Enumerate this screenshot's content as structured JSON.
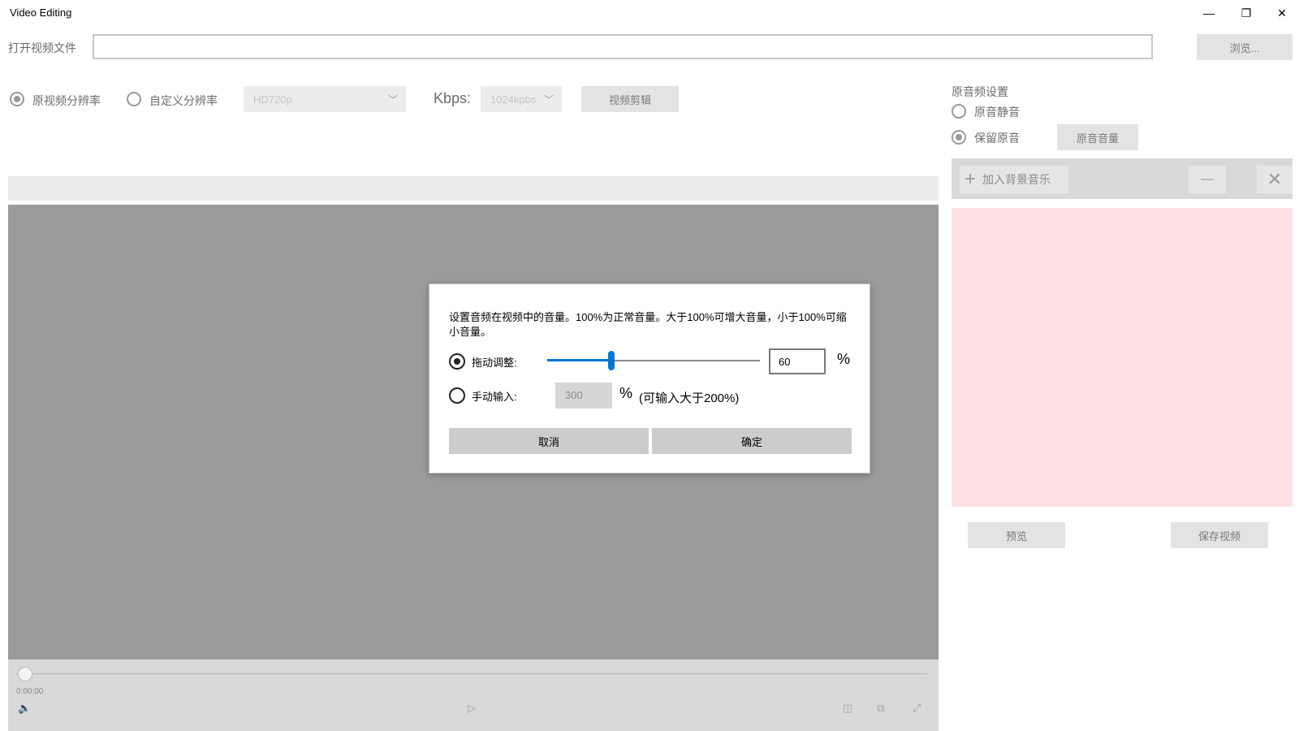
{
  "window": {
    "title": "Video Editing",
    "minimize": "—",
    "restore": "❐",
    "close": "✕"
  },
  "file": {
    "label": "打开视频文件",
    "value": "",
    "browse_label": "浏览..."
  },
  "resolution": {
    "original_label": "原视频分辨率",
    "custom_label": "自定义分辨率",
    "preset_value": "HD720p",
    "kbps_label": "Kbps:",
    "kbps_value": "1024kpbs",
    "edit_button": "视频剪辑"
  },
  "player": {
    "time": "0:00:00",
    "volume_icon": "🔈",
    "play_icon": "▷",
    "cc_icon": "◫",
    "cast_icon": "⧉",
    "fullscreen_icon": "⤢"
  },
  "audio": {
    "section_title": "原音频设置",
    "mute_label": "原音静音",
    "keep_label": "保留原音",
    "volume_button": "原音音量",
    "add_music_label": "加入背景音乐",
    "add_icon": "+",
    "minus_icon": "—",
    "close_icon": "✕",
    "preview_button": "预览",
    "save_button": "保存视频"
  },
  "dialog": {
    "description": "设置音频在视频中的音量。100%为正常音量。大于100%可增大音量，小于100%可缩小音量。",
    "drag_label": "拖动调整:",
    "slider_value": "60",
    "slider_level": 0.3,
    "percent": "%",
    "manual_label": "手动输入:",
    "manual_value": "300",
    "manual_hint": "(可输入大于200%)",
    "cancel": "取消",
    "confirm": "确定"
  },
  "colors": {
    "accent": "#0078d7",
    "music_list_bg": "#ffe0e3",
    "video_bg": "#9b9b9b"
  }
}
